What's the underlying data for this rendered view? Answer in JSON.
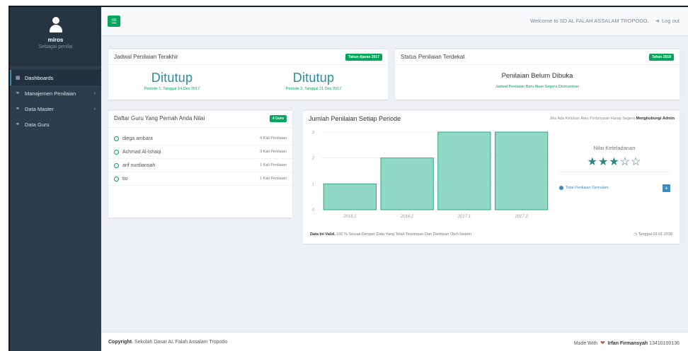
{
  "sidebar": {
    "user_name": "miros",
    "user_role": "Sebagai penilai",
    "items": [
      {
        "label": "Dashboards",
        "icon": "dashboard-icon",
        "active": true
      },
      {
        "label": "Manajemen Penilaian",
        "icon": "tag-icon",
        "has_submenu": true
      },
      {
        "label": "Data Master",
        "icon": "tag-icon",
        "has_submenu": true
      },
      {
        "label": "Data Guru",
        "icon": "tag-icon"
      }
    ]
  },
  "topbar": {
    "welcome": "Welcome to SD AL FALAH ASSALAM TROPODO.",
    "logout": "Log out"
  },
  "schedule": {
    "title": "Jadwal Penilaian Terakhir",
    "badge": "Tahun Ajaran 2017",
    "periods": [
      {
        "status": "Ditutup",
        "detail": "Periode 1, Tanggal 14 Des 2017"
      },
      {
        "status": "Ditutup",
        "detail": "Periode 2, Tanggal 21 Des 2017"
      }
    ]
  },
  "status": {
    "title": "Status Penilaian Terdekat",
    "badge": "Tahun 2018",
    "main": "Penilaian Belum Dibuka",
    "sub": "Jadwal Penilaian Baru Akan Segera Diumumkan"
  },
  "teachers": {
    "title": "Daftar Guru Yang Pernah Anda Nilai",
    "badge": "4 Guru",
    "rows": [
      {
        "name": "diega ambara",
        "count": "4 Kali Penilaian"
      },
      {
        "name": "Achmad Al-Ishaqi",
        "count": "3 Kali Penilaian"
      },
      {
        "name": "arif nurdiansah",
        "count": "1 Kali Penilaian"
      },
      {
        "name": "tio",
        "count": "1 Kali Penilaian"
      }
    ]
  },
  "chart_panel": {
    "title": "Jumlah Penilaian Setiap Periode",
    "header_note": "Jika Ada Keluhan Atau Pertanyaan Harap Segera",
    "header_note_bold": "Menghubungi Admin",
    "rating_label": "Nilai Keteladanan",
    "stars_filled": 3,
    "stars_total": 5,
    "total_link": "Total Penilaian Semulam",
    "plus": "+",
    "note_bold": "Data Ini Valid.",
    "note": "100 % Sesuai Dengan Data Yang Telah Tersimpan Dan Disimpan Oleh Sistem.",
    "date": "Tanggal 03.01.2018"
  },
  "chart_data": {
    "type": "bar",
    "categories": [
      "2016.1",
      "2016.2",
      "2017.1",
      "2017.2"
    ],
    "values": [
      1,
      2,
      3,
      3
    ],
    "ylim": [
      0,
      3
    ],
    "yticks": [
      0,
      1,
      2,
      3
    ],
    "color": "#8fd9c5",
    "edge_color": "#2fa78a",
    "grid": true
  },
  "footer": {
    "copyright_bold": "Copyright",
    "copyright": ". Sekolah Dasar AL Falah Assalam Tropodo",
    "made_with": "Made With",
    "author": "Irfan Firmansyah",
    "author_id": "13410100136"
  },
  "colors": {
    "sidebar_bg": "#2c3e4c",
    "accent_green": "#00a65a",
    "accent_blue": "#3c8dbc",
    "bar_fill": "#8fd9c5"
  }
}
